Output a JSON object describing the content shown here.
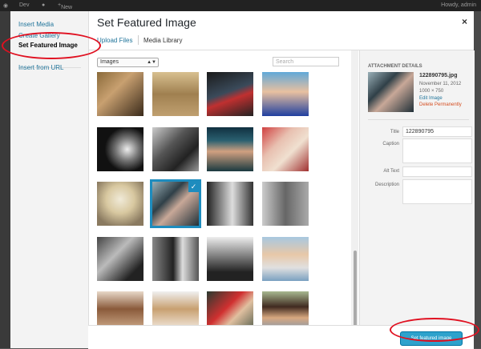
{
  "adminbar": {
    "site": "Dev",
    "new": "New",
    "user": "Howdy, admin"
  },
  "menu": {
    "insert_media": "Insert Media",
    "create_gallery": "Create Gallery",
    "set_featured": "Set Featured Image",
    "insert_url": "Insert from URL"
  },
  "frame": {
    "title": "Set Featured Image",
    "close": "×"
  },
  "tabs": {
    "upload": "Upload Files",
    "library": "Media Library"
  },
  "toolbar": {
    "filter": "Images",
    "search_placeholder": "Search"
  },
  "sidebar": {
    "heading": "ATTACHMENT DETAILS",
    "filename": "122890795.jpg",
    "date": "November 11, 2012",
    "dimensions": "1000 × 750",
    "edit": "Edit Image",
    "delete": "Delete Permanently",
    "title_label": "Title",
    "title_value": "122890795",
    "caption_label": "Caption",
    "alt_label": "Alt Text",
    "description_label": "Description"
  },
  "footer": {
    "button": "Set featured image"
  },
  "colors": {
    "accent": "#21759b",
    "primary_btn": "#2ea2cc",
    "selection": "#1e8cbe",
    "delete": "#d54e21",
    "annotation": "#e01020"
  }
}
